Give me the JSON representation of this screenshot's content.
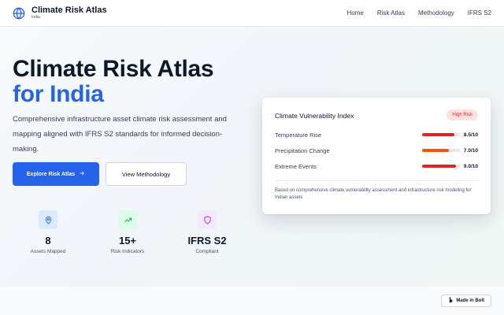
{
  "header": {
    "brand_title": "Climate Risk Atlas",
    "brand_sub": "India",
    "nav": [
      "Home",
      "Risk Atlas",
      "Methodology",
      "IFRS S2"
    ]
  },
  "hero": {
    "title_line1": "Climate Risk Atlas",
    "title_line2": "for India",
    "description": "Comprehensive infrastructure asset climate risk assessment and mapping aligned with IFRS S2 standards for informed decision-making.",
    "primary_button": "Explore Risk Atlas",
    "secondary_button": "View Methodology"
  },
  "stats": [
    {
      "value": "8",
      "label": "Assets Mapped",
      "icon": "map-pin-icon"
    },
    {
      "value": "15+",
      "label": "Risk Indicators",
      "icon": "trending-up-icon"
    },
    {
      "value": "IFRS S2",
      "label": "Compliant",
      "icon": "shield-icon"
    }
  ],
  "card": {
    "title": "Climate Vulnerability Index",
    "badge": "High Risk",
    "rows": [
      {
        "label": "Temperature Rise",
        "value": "8.5/10",
        "score": 8.5,
        "color": "#dc2626"
      },
      {
        "label": "Precipitation Change",
        "value": "7.0/10",
        "score": 7.0,
        "color": "#ea580c"
      },
      {
        "label": "Extreme Events",
        "value": "9.0/10",
        "score": 9.0,
        "color": "#dc2626"
      }
    ],
    "note": "Based on comprehensive climate vulnerability assessment and infrastructure risk modeling for Indian assets"
  },
  "footer": {
    "made_in": "Made in Bolt"
  },
  "colors": {
    "accent": "#2563eb",
    "danger": "#dc2626",
    "warning": "#ea580c"
  }
}
